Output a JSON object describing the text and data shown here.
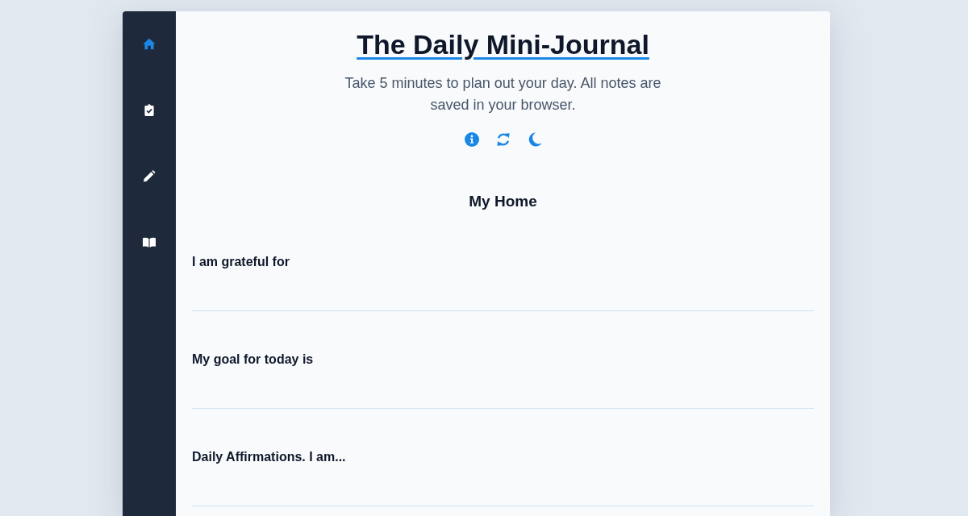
{
  "sidebar": {
    "items": [
      {
        "kind": "home",
        "selected": true
      },
      {
        "kind": "clipboard",
        "selected": false
      },
      {
        "kind": "pencil",
        "selected": false
      },
      {
        "kind": "book",
        "selected": false
      }
    ]
  },
  "header": {
    "title": "The Daily Mini-Journal",
    "subtitle": "Take 5 minutes to plan out your day. All notes are saved in your browser.",
    "actions": [
      {
        "kind": "info"
      },
      {
        "kind": "refresh"
      },
      {
        "kind": "moon"
      }
    ]
  },
  "section": {
    "title": "My Home",
    "fields": [
      {
        "label": "I am grateful for"
      },
      {
        "label": "My goal for today is"
      },
      {
        "label": "Daily Affirmations. I am..."
      }
    ]
  }
}
